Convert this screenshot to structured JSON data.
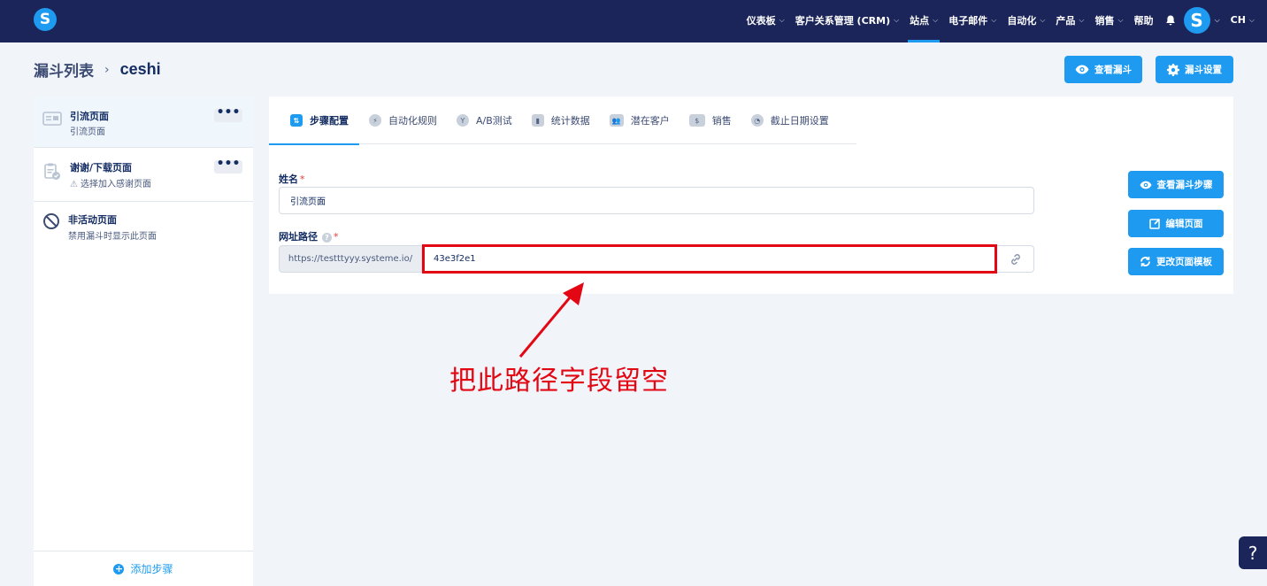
{
  "nav": {
    "items": [
      {
        "label": "仪表板",
        "chev": "⌵"
      },
      {
        "label": "客户关系管理 (CRM)",
        "chev": "⌵"
      },
      {
        "label": "站点",
        "chev": "⌵"
      },
      {
        "label": "电子邮件",
        "chev": "⌵"
      },
      {
        "label": "自动化",
        "chev": "⌵"
      },
      {
        "label": "产品",
        "chev": "⌵"
      },
      {
        "label": "销售",
        "chev": "⌵"
      },
      {
        "label": "帮助"
      }
    ],
    "active_item": "站点",
    "logo": "S",
    "avatar": "S",
    "lang": "CH",
    "lang_chev": "⌵"
  },
  "breadcrumb": {
    "parent": "漏斗列表",
    "separator": "›",
    "current": "ceshi"
  },
  "header_buttons": {
    "view_funnel": "查看漏斗",
    "funnel_settings": "漏斗设置"
  },
  "sidebar": {
    "steps": [
      {
        "title": "引流页面",
        "subtitle": "引流页面",
        "menu": "•••"
      },
      {
        "title": "谢谢/下载页面",
        "subtitle": "选择加入感谢页面",
        "menu": "•••",
        "warning": "⚠"
      },
      {
        "title": "非活动页面",
        "subtitle": "禁用漏斗时显示此页面"
      }
    ],
    "add_step": "添加步骤",
    "add_icon": "+"
  },
  "tabs": [
    {
      "label": "步骤配置",
      "icon": "⇅"
    },
    {
      "label": "自动化规则",
      "icon": "⚡"
    },
    {
      "label": "A/B测试",
      "icon": "Y"
    },
    {
      "label": "统计数据",
      "icon": "▮"
    },
    {
      "label": "潜在客户",
      "icon": "👥"
    },
    {
      "label": "销售",
      "icon": "$"
    },
    {
      "label": "截止日期设置",
      "icon": "◔"
    }
  ],
  "form": {
    "name_label": "姓名",
    "required_mark": "*",
    "name_value": "引流页面",
    "path_label": "网址路径",
    "help_mark": "?",
    "path_prefix": "https://testttyyy.systeme.io/",
    "path_value": "43e3f2e1"
  },
  "side_buttons": {
    "view_steps": "查看漏斗步骤",
    "edit_page": "编辑页面",
    "change_template": "更改页面模板"
  },
  "annotation": "把此路径字段留空",
  "help_button": "?",
  "colors": {
    "nav_bg": "#1b2559",
    "accent": "#1e9bf0",
    "highlight_red": "#e30613",
    "page_bg": "#f1f4f9"
  }
}
